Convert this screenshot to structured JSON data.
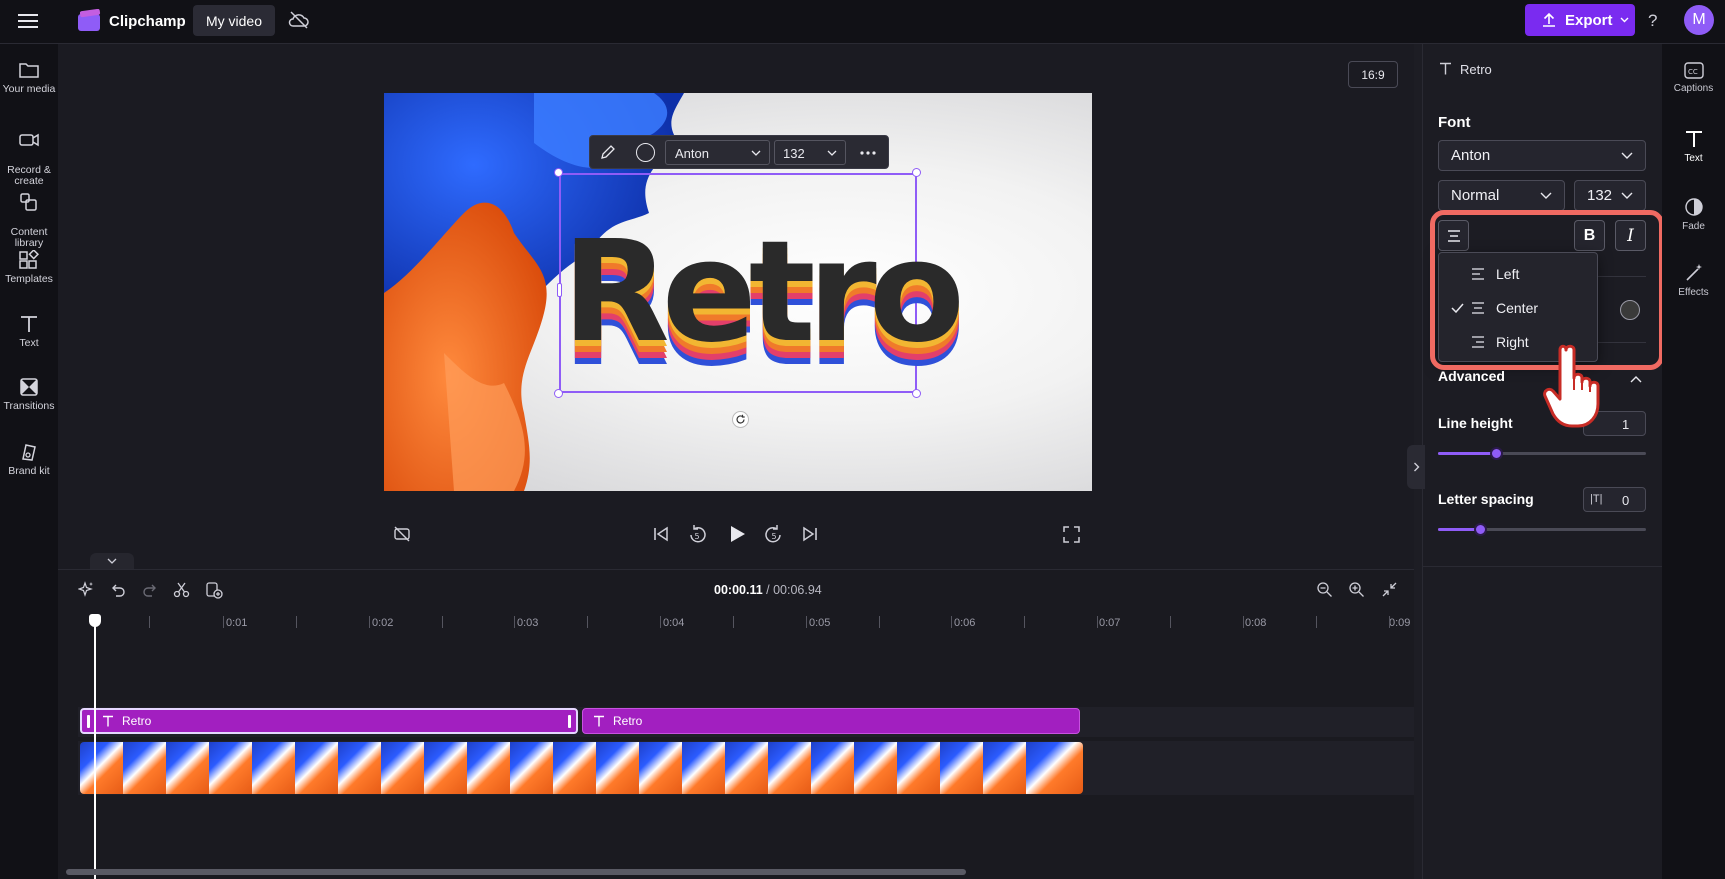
{
  "app": {
    "name": "Clipchamp",
    "project_title": "My video",
    "export_label": "Export",
    "help": "?",
    "avatar_initial": "M",
    "accent": "#7a2bf0"
  },
  "left_nav": [
    {
      "label": "Your media"
    },
    {
      "label": "Record &\ncreate"
    },
    {
      "label": "Content\nlibrary"
    },
    {
      "label": "Templates"
    },
    {
      "label": "Text"
    },
    {
      "label": "Transitions"
    },
    {
      "label": "Brand kit"
    }
  ],
  "right_nav": [
    {
      "label": "Captions"
    },
    {
      "label": "Text"
    },
    {
      "label": "Fade"
    },
    {
      "label": "Effects"
    }
  ],
  "preview": {
    "aspect_ratio": "16:9",
    "overlay_text": "Retro",
    "toolbar": {
      "font": "Anton",
      "size": "132"
    }
  },
  "properties": {
    "header": "Retro",
    "font_section": "Font",
    "font_value": "Anton",
    "weight_value": "Normal",
    "size_value": "132",
    "bold_label": "B",
    "italic_label": "I",
    "align_menu": {
      "left": "Left",
      "center": "Center",
      "right": "Right",
      "selected": "Center"
    },
    "advanced": "Advanced",
    "line_height_label": "Line height",
    "line_height_value": "1",
    "line_height_fraction": 0.28,
    "letter_spacing_label": "Letter spacing",
    "letter_spacing_value": "0",
    "letter_spacing_fraction": 0.2,
    "letter_spacing_icon_text": "|T|"
  },
  "timeline": {
    "current_time": "00:00.11",
    "total_time": "/ 00:06.94",
    "ruler": [
      "0:01",
      "0:02",
      "0:03",
      "0:04",
      "0:05",
      "0:06",
      "0:07",
      "0:08",
      "0:09"
    ],
    "clips": [
      {
        "label": "Retro"
      },
      {
        "label": "Retro"
      }
    ]
  }
}
